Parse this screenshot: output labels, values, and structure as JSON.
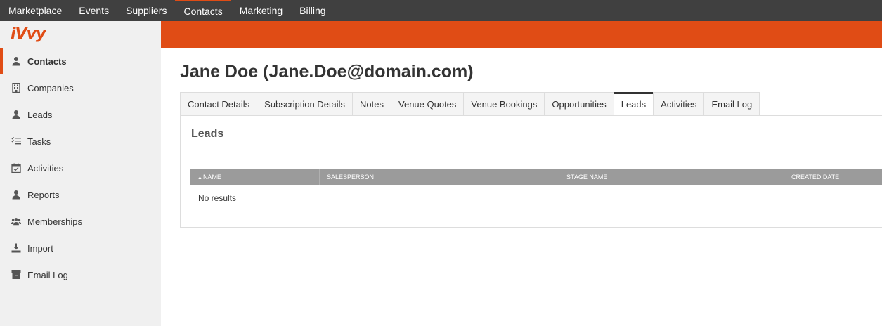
{
  "topnav": {
    "items": [
      {
        "label": "Marketplace"
      },
      {
        "label": "Events"
      },
      {
        "label": "Suppliers"
      },
      {
        "label": "Contacts",
        "active": true
      },
      {
        "label": "Marketing"
      },
      {
        "label": "Billing"
      }
    ]
  },
  "brand": {
    "logo_text": "iVvy",
    "accent_color": "#e04c15"
  },
  "sidebar": {
    "items": [
      {
        "label": "Contacts",
        "icon": "person-icon",
        "active": true
      },
      {
        "label": "Companies",
        "icon": "building-icon"
      },
      {
        "label": "Leads",
        "icon": "person-icon"
      },
      {
        "label": "Tasks",
        "icon": "checklist-icon"
      },
      {
        "label": "Activities",
        "icon": "calendar-check-icon"
      },
      {
        "label": "Reports",
        "icon": "person-icon"
      },
      {
        "label": "Memberships",
        "icon": "users-icon"
      },
      {
        "label": "Import",
        "icon": "download-icon"
      },
      {
        "label": "Email Log",
        "icon": "archive-icon"
      }
    ]
  },
  "page": {
    "title": "Jane Doe (Jane.Doe@domain.com)"
  },
  "tabs": [
    {
      "label": "Contact Details"
    },
    {
      "label": "Subscription Details"
    },
    {
      "label": "Notes"
    },
    {
      "label": "Venue Quotes"
    },
    {
      "label": "Venue Bookings"
    },
    {
      "label": "Opportunities"
    },
    {
      "label": "Leads",
      "active": true
    },
    {
      "label": "Activities"
    },
    {
      "label": "Email Log"
    }
  ],
  "leads": {
    "title": "Leads",
    "columns": [
      "NAME",
      "SALESPERSON",
      "STAGE NAME",
      "CREATED DATE"
    ],
    "sorted_column": "NAME",
    "empty_text": "No results"
  }
}
